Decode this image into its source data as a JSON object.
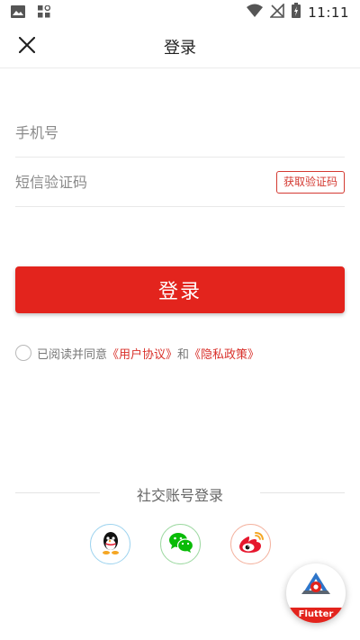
{
  "status_bar": {
    "time": "11:11",
    "left_icons": [
      "image-icon",
      "app-grid-icon"
    ],
    "right_icons": [
      "wifi-icon",
      "no-signal-icon",
      "battery-charging-icon"
    ]
  },
  "header": {
    "title": "登录",
    "close_icon": "close-icon"
  },
  "form": {
    "phone_placeholder": "手机号",
    "phone_value": "",
    "code_placeholder": "短信验证码",
    "code_value": "",
    "get_code_label": "获取验证码"
  },
  "login_button_label": "登录",
  "agreement": {
    "checked": false,
    "prefix": "已阅读并同意",
    "user_agreement": "《用户协议》",
    "and": "和",
    "privacy_policy": "《隐私政策》"
  },
  "social": {
    "title": "社交账号登录",
    "providers": [
      {
        "name": "qq",
        "icon": "qq-icon"
      },
      {
        "name": "wechat",
        "icon": "wechat-icon"
      },
      {
        "name": "weibo",
        "icon": "weibo-icon"
      }
    ]
  },
  "flutter_badge": {
    "label": "Flutter"
  },
  "colors": {
    "accent": "#e3241d",
    "link": "#d9302a",
    "qq": "#1296db",
    "wechat": "#09bb07",
    "weibo": "#e6162d"
  }
}
